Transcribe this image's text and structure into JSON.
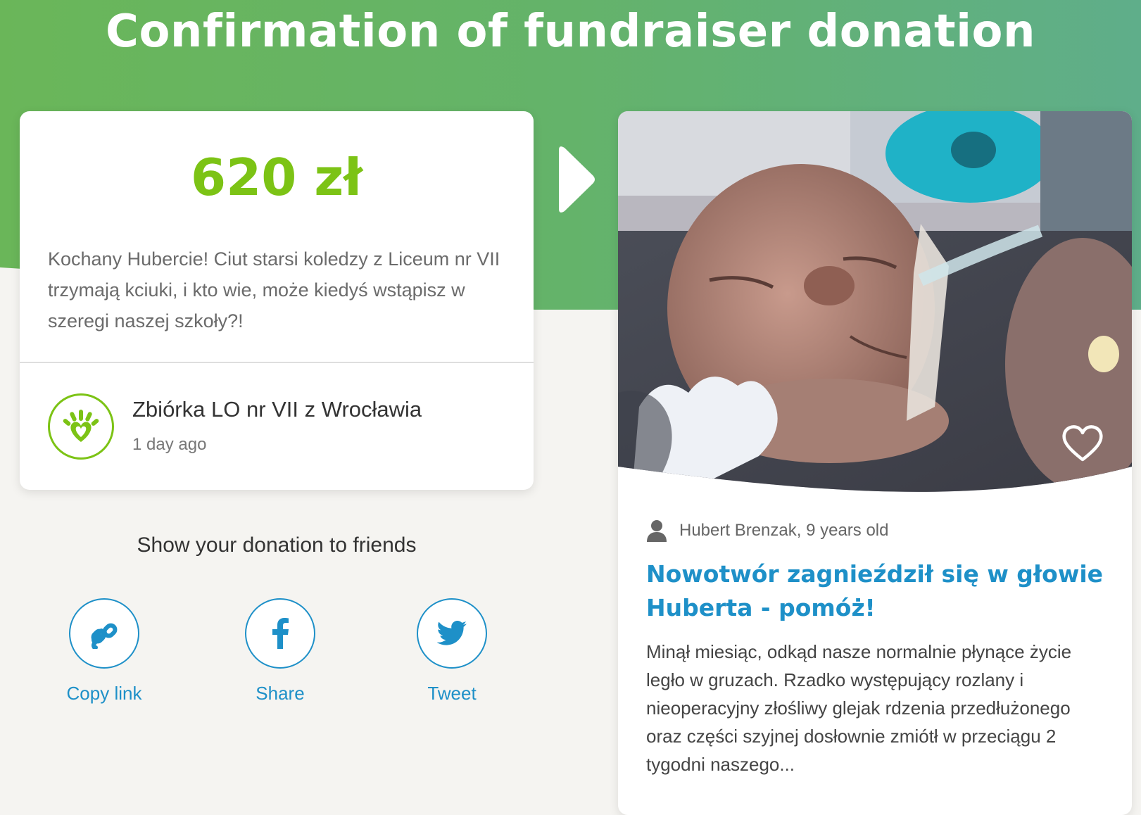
{
  "page": {
    "title": "Confirmation of fundraiser donation"
  },
  "donation": {
    "amount": "620 zł",
    "message": "Kochany Hubercie! Ciut starsi koledzy z Liceum nr VII trzymają kciuki, i kto wie, może kiedyś wstąpisz w szeregi naszej szkoły?!",
    "donor_name": "Zbiórka LO nr VII z Wrocławia",
    "time": "1 day ago"
  },
  "share": {
    "heading": "Show your donation to friends",
    "buttons": [
      {
        "label": "Copy link",
        "icon": "link-icon"
      },
      {
        "label": "Share",
        "icon": "facebook-icon"
      },
      {
        "label": "Tweet",
        "icon": "twitter-icon"
      }
    ]
  },
  "campaign": {
    "beneficiary": "Hubert Brenzak, 9 years old",
    "title": "Nowotwór zagnieździł się w głowie Huberta - pomóż!",
    "description": "Minął miesiąc, odkąd nasze normalnie płynące życie legło w gruzach. Rzadko występujący rozlany i nieoperacyjny złośliwy glejak rdzenia przedłużonego oraz części szyjnej dosłownie zmiótł w przeciągu 2 tygodni naszego..."
  },
  "colors": {
    "brand_green": "#7cc315",
    "header_green": "#6ab659",
    "link_blue": "#1e90c8"
  }
}
